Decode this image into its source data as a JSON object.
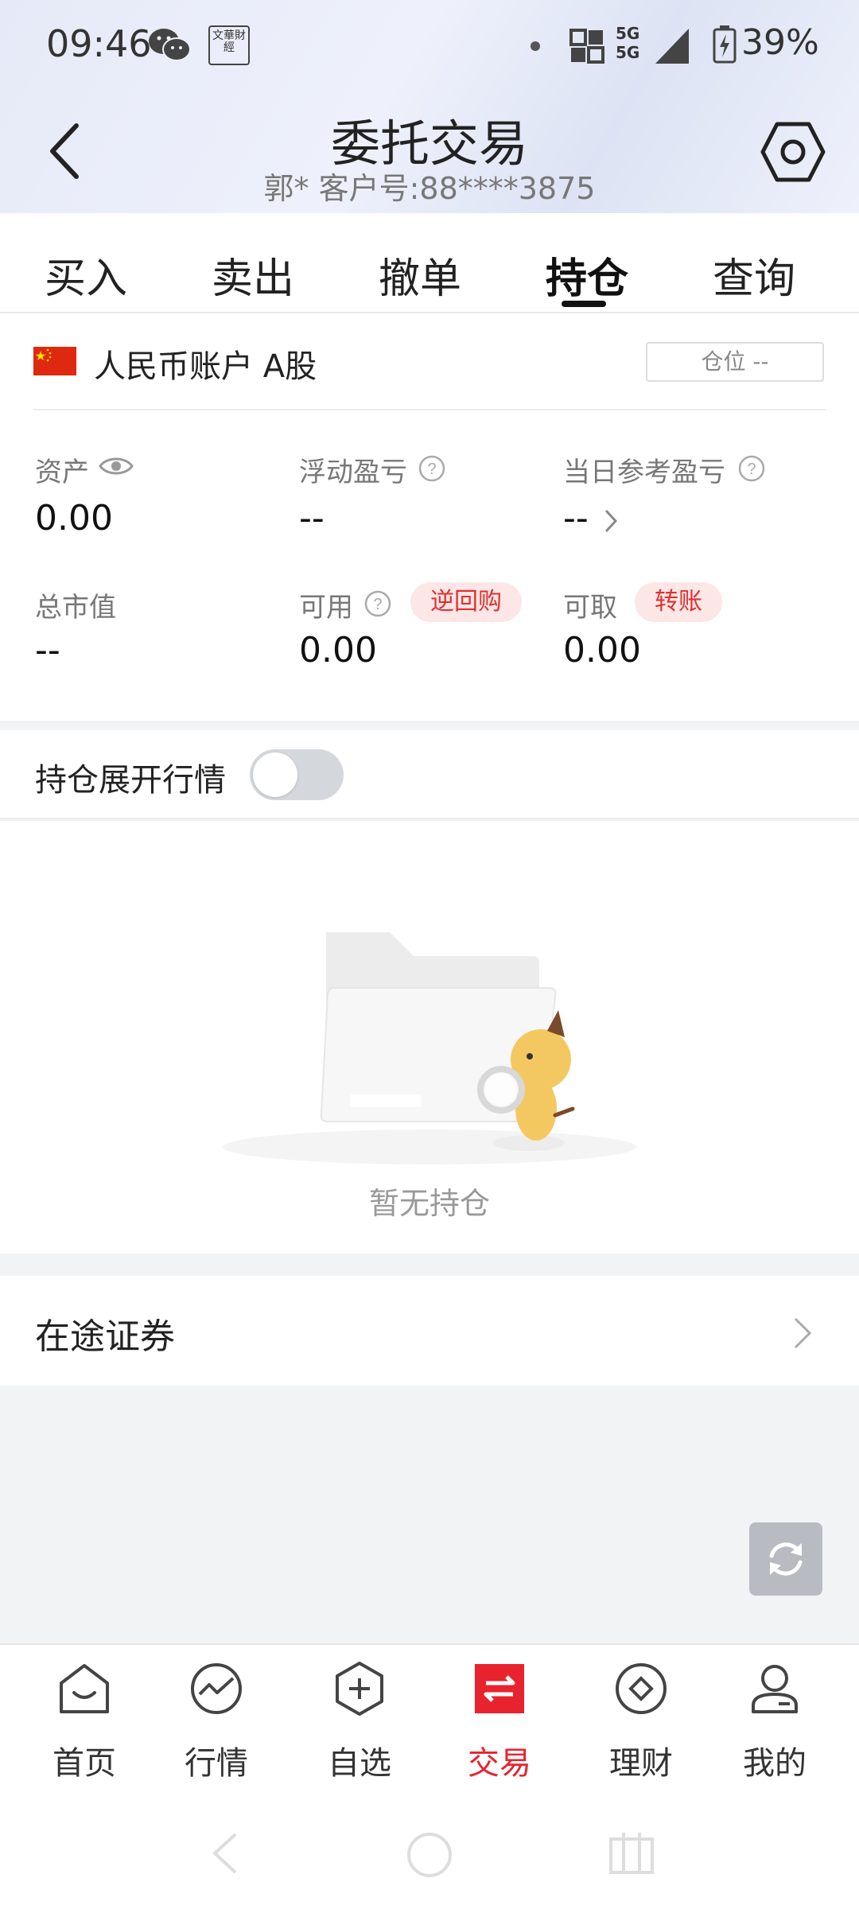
{
  "status_bar": {
    "time": "09:46",
    "news_badge": "文華財經",
    "network": "5G",
    "battery": "39%"
  },
  "header": {
    "title": "委托交易",
    "subtitle": "郭* 客户号:88****3875"
  },
  "tabs": [
    {
      "label": "买入"
    },
    {
      "label": "卖出"
    },
    {
      "label": "撤单"
    },
    {
      "label": "持仓",
      "active": true
    },
    {
      "label": "查询"
    }
  ],
  "account": {
    "label": "人民币账户 A股",
    "position_button": "仓位 --",
    "assets_label": "资产",
    "assets_value": "0.00",
    "floating_pl_label": "浮动盈亏",
    "floating_pl_value": "--",
    "daily_pl_label": "当日参考盈亏",
    "daily_pl_value": "--",
    "market_value_label": "总市值",
    "market_value_value": "--",
    "available_label": "可用",
    "available_value": "0.00",
    "reverse_repo_button": "逆回购",
    "withdrawable_label": "可取",
    "withdrawable_value": "0.00",
    "transfer_button": "转账"
  },
  "toggle_row": {
    "label": "持仓展开行情",
    "on": false
  },
  "empty_state": {
    "text": "暂无持仓"
  },
  "transit": {
    "label": "在途证券"
  },
  "bottom_nav": [
    {
      "label": "首页",
      "icon": "home-icon"
    },
    {
      "label": "行情",
      "icon": "market-icon"
    },
    {
      "label": "自选",
      "icon": "watchlist-icon"
    },
    {
      "label": "交易",
      "icon": "trade-icon",
      "active": true
    },
    {
      "label": "理财",
      "icon": "wealth-icon"
    },
    {
      "label": "我的",
      "icon": "profile-icon"
    }
  ],
  "colors": {
    "accent": "#e8232e",
    "pill_bg": "#fde6e6",
    "pill_text": "#e03030"
  }
}
